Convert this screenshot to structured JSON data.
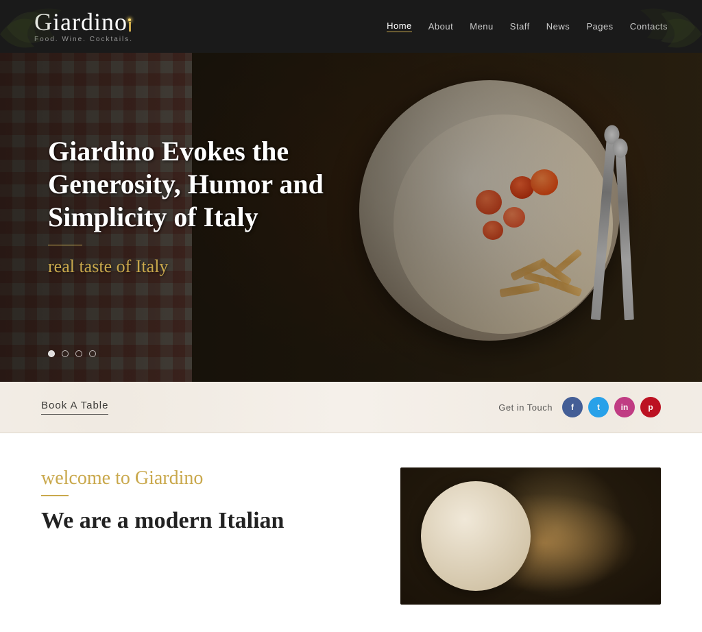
{
  "header": {
    "logo": {
      "name": "Giardino",
      "tagline": "Food. Wine. Cocktails."
    },
    "nav": {
      "items": [
        {
          "label": "Home",
          "active": true
        },
        {
          "label": "About"
        },
        {
          "label": "Menu"
        },
        {
          "label": "Staff"
        },
        {
          "label": "News"
        },
        {
          "label": "Pages"
        },
        {
          "label": "Contacts"
        }
      ]
    }
  },
  "hero": {
    "title": "Giardino Evokes the Generosity, Humor and Simplicity of Italy",
    "subtitle": "real taste of Italy",
    "dots": [
      1,
      2,
      3,
      4
    ]
  },
  "action_bar": {
    "book_table_label": "Book A Table",
    "get_in_touch_label": "Get in Touch",
    "social": [
      {
        "name": "facebook",
        "letter": "f"
      },
      {
        "name": "twitter",
        "letter": "t"
      },
      {
        "name": "instagram",
        "letter": "in"
      },
      {
        "name": "pinterest",
        "letter": "p"
      }
    ]
  },
  "welcome": {
    "script_title": "welcome to Giardino",
    "main_title": "We are a modern Italian"
  }
}
